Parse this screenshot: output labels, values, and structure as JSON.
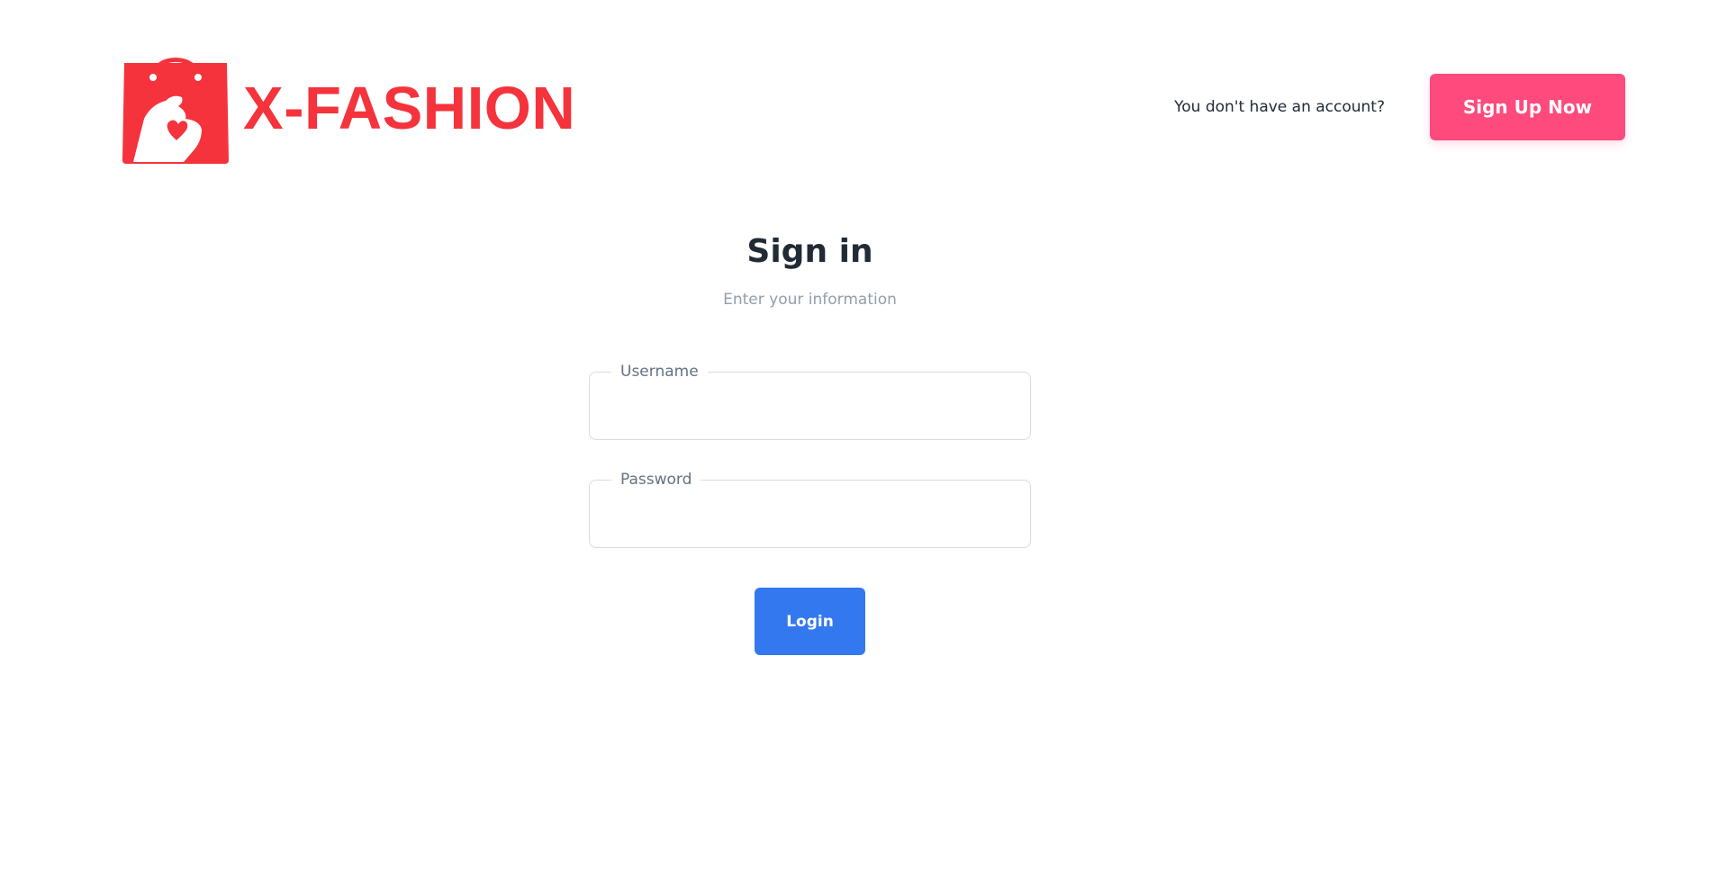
{
  "brand": {
    "name": "X-FASHION",
    "color": "#f5333c"
  },
  "header": {
    "account_prompt": "You don't have an account?",
    "signup_label": "Sign Up Now",
    "signup_color": "#ff4a7d"
  },
  "form": {
    "title": "Sign in",
    "subtitle": "Enter your information",
    "username": {
      "label": "Username",
      "value": ""
    },
    "password": {
      "label": "Password",
      "value": ""
    },
    "login_label": "Login",
    "login_color": "#3478f0"
  }
}
